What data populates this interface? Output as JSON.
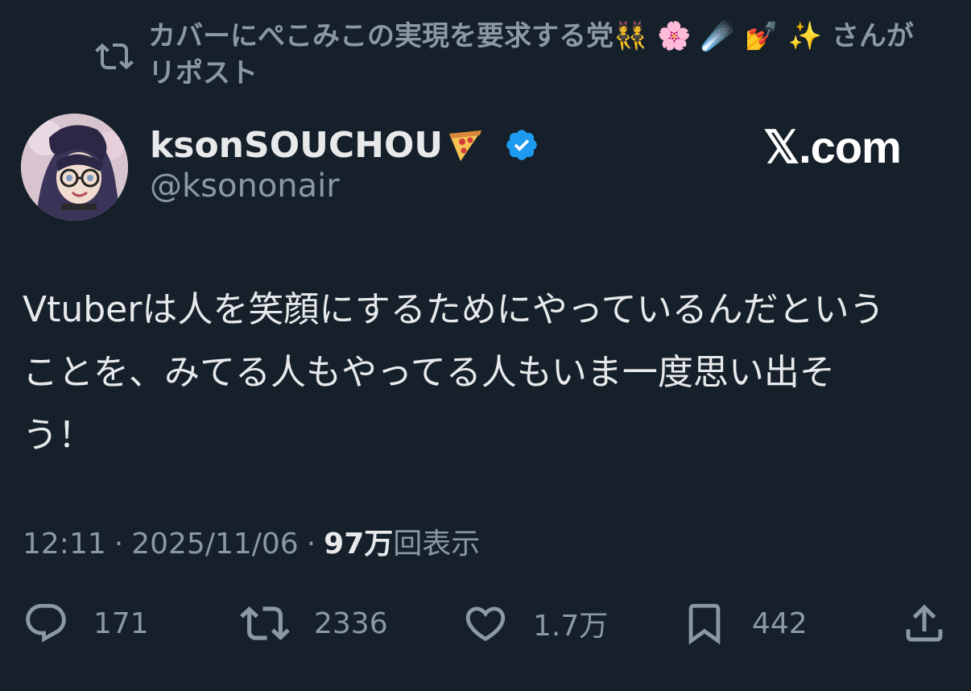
{
  "repost": {
    "text": "カバーにぺこみこの実現を要求する党👯 🌸 ☄️ 💅 ✨ さんがリポスト"
  },
  "author": {
    "display_name": "ksonSOUCHOU",
    "handle": "@ksononair",
    "avatar_icon": "avatar-image",
    "verified_icon": "verified-badge-icon"
  },
  "brand": {
    "watermark": "𝕏.com"
  },
  "tweet": {
    "text": "Vtuberは人を笑顔にするためにやっているんだという\nことを、みてる人もやってる人もいま一度思い出そ\nう！"
  },
  "meta": {
    "time": "12:11",
    "sep1": "·",
    "date": "2025/11/06",
    "sep2": "·",
    "views_count": "97万",
    "views_label": "回表示"
  },
  "actions": {
    "reply_count": "171",
    "repost_count": "2336",
    "like_count": "1.7万",
    "bookmark_count": "442"
  },
  "colors": {
    "background": "#15202b",
    "text_primary": "#e7e9ea",
    "text_secondary": "#8b98a5",
    "verified": "#1d9bf0"
  }
}
